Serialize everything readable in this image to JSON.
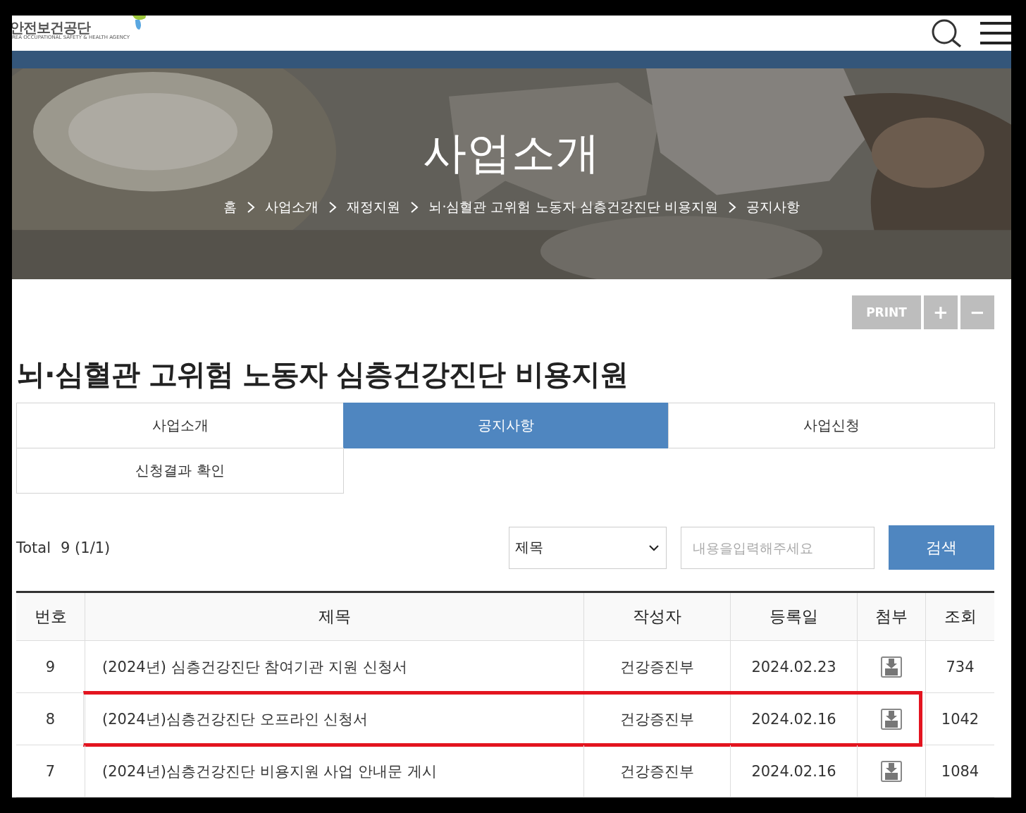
{
  "header": {
    "logo_text": "안전보건공단",
    "logo_subtext": "REA OCCUPATIONAL SAFETY & HEALTH AGENCY"
  },
  "hero": {
    "title": "사업소개",
    "breadcrumb": [
      "홈",
      "사업소개",
      "재정지원",
      "뇌·심혈관 고위험 노동자 심층건강진단 비용지원",
      "공지사항"
    ]
  },
  "tools": [
    "PRINT",
    "+",
    "−"
  ],
  "page_title": "뇌·심혈관 고위험 노동자 심층건강진단 비용지원",
  "tabs": [
    {
      "label": "사업소개",
      "selected": false
    },
    {
      "label": "공지사항",
      "selected": true
    },
    {
      "label": "사업신청",
      "selected": false
    },
    {
      "label": "신청결과 확인",
      "selected": false
    }
  ],
  "board": {
    "total_label": "Total",
    "total": "9 (1/1)",
    "search_select": {
      "value": "제목"
    },
    "search_input": {
      "placeholder": "내용을입력해주세요"
    },
    "search_button": "검색",
    "columns": [
      "번호",
      "제목",
      "작성자",
      "등록일",
      "첨부",
      "조회"
    ],
    "rows": [
      {
        "number": "9",
        "title": "(2024년) 심층건강진단 참여기관 지원 신청서",
        "author": "건강증진부",
        "date": "2024.02.23",
        "attachment": true,
        "views": "734",
        "highlighted": false
      },
      {
        "number": "8",
        "title": "(2024년)심층건강진단 오프라인 신청서",
        "author": "건강증진부",
        "date": "2024.02.16",
        "attachment": true,
        "views": "1042",
        "highlighted": true
      },
      {
        "number": "7",
        "title": "(2024년)심층건강진단 비용지원 사업 안내문 게시",
        "author": "건강증진부",
        "date": "2024.02.16",
        "attachment": true,
        "views": "1084",
        "highlighted": false
      }
    ]
  }
}
